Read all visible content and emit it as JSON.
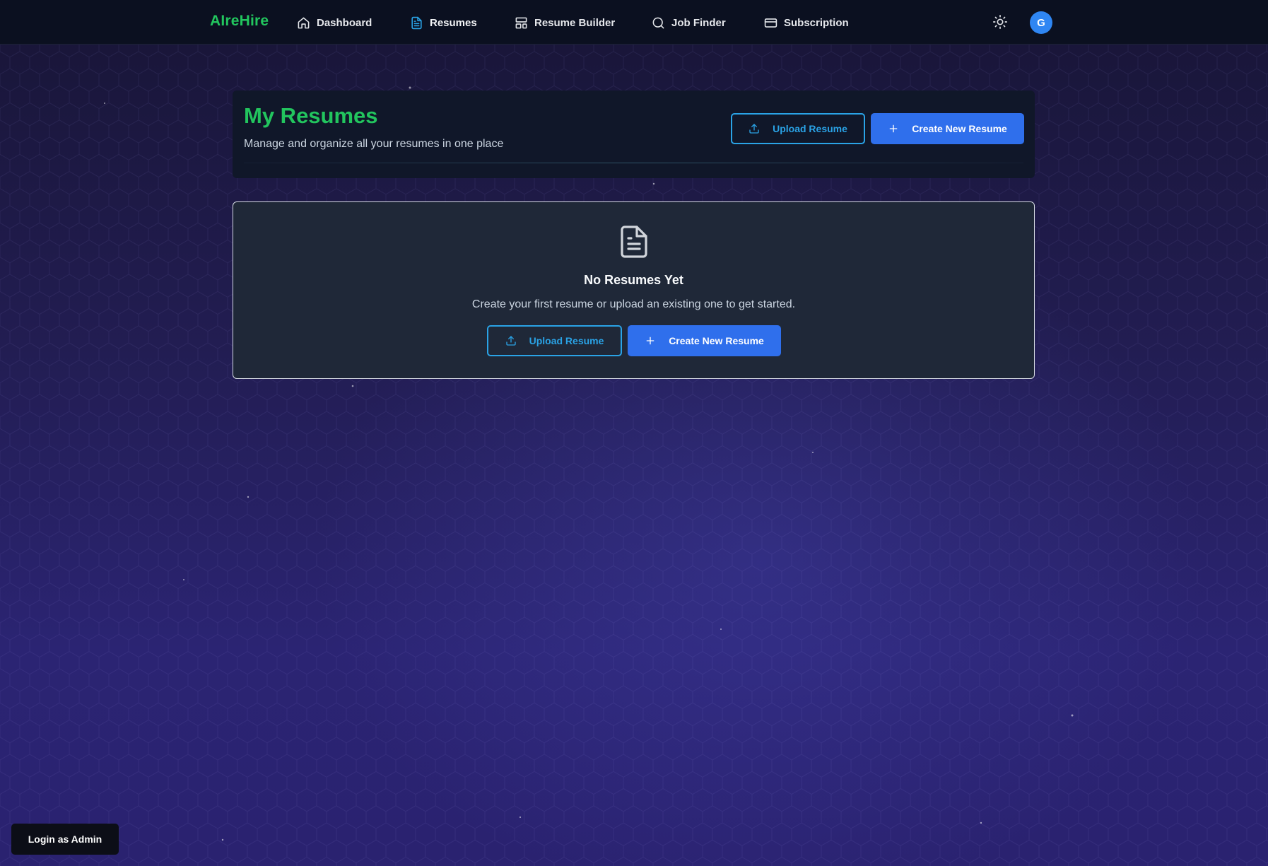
{
  "nav": {
    "brand": "AIreHire",
    "items": [
      {
        "label": "Dashboard",
        "icon": "home-icon"
      },
      {
        "label": "Resumes",
        "icon": "file-text-icon",
        "active": true
      },
      {
        "label": "Resume Builder",
        "icon": "layout-icon"
      },
      {
        "label": "Job Finder",
        "icon": "search-icon"
      },
      {
        "label": "Subscription",
        "icon": "credit-card-icon"
      }
    ],
    "theme_icon": "sun-icon",
    "avatar_initial": "G"
  },
  "header": {
    "title": "My Resumes",
    "subtitle": "Manage and organize all your resumes in one place",
    "upload_label": "Upload Resume",
    "create_label": "Create New Resume"
  },
  "empty_state": {
    "icon": "document-icon",
    "title": "No Resumes Yet",
    "text": "Create your first resume or upload an existing one to get started.",
    "upload_label": "Upload Resume",
    "create_label": "Create New Resume"
  },
  "admin": {
    "label": "Login as Admin"
  },
  "colors": {
    "brand_green": "#22c55e",
    "accent_blue": "#2f6fec",
    "outline_blue": "#2aa3e6",
    "avatar_blue": "#2f86f3",
    "navbar_bg": "#0b1020",
    "card_bg": "#1f2838"
  }
}
